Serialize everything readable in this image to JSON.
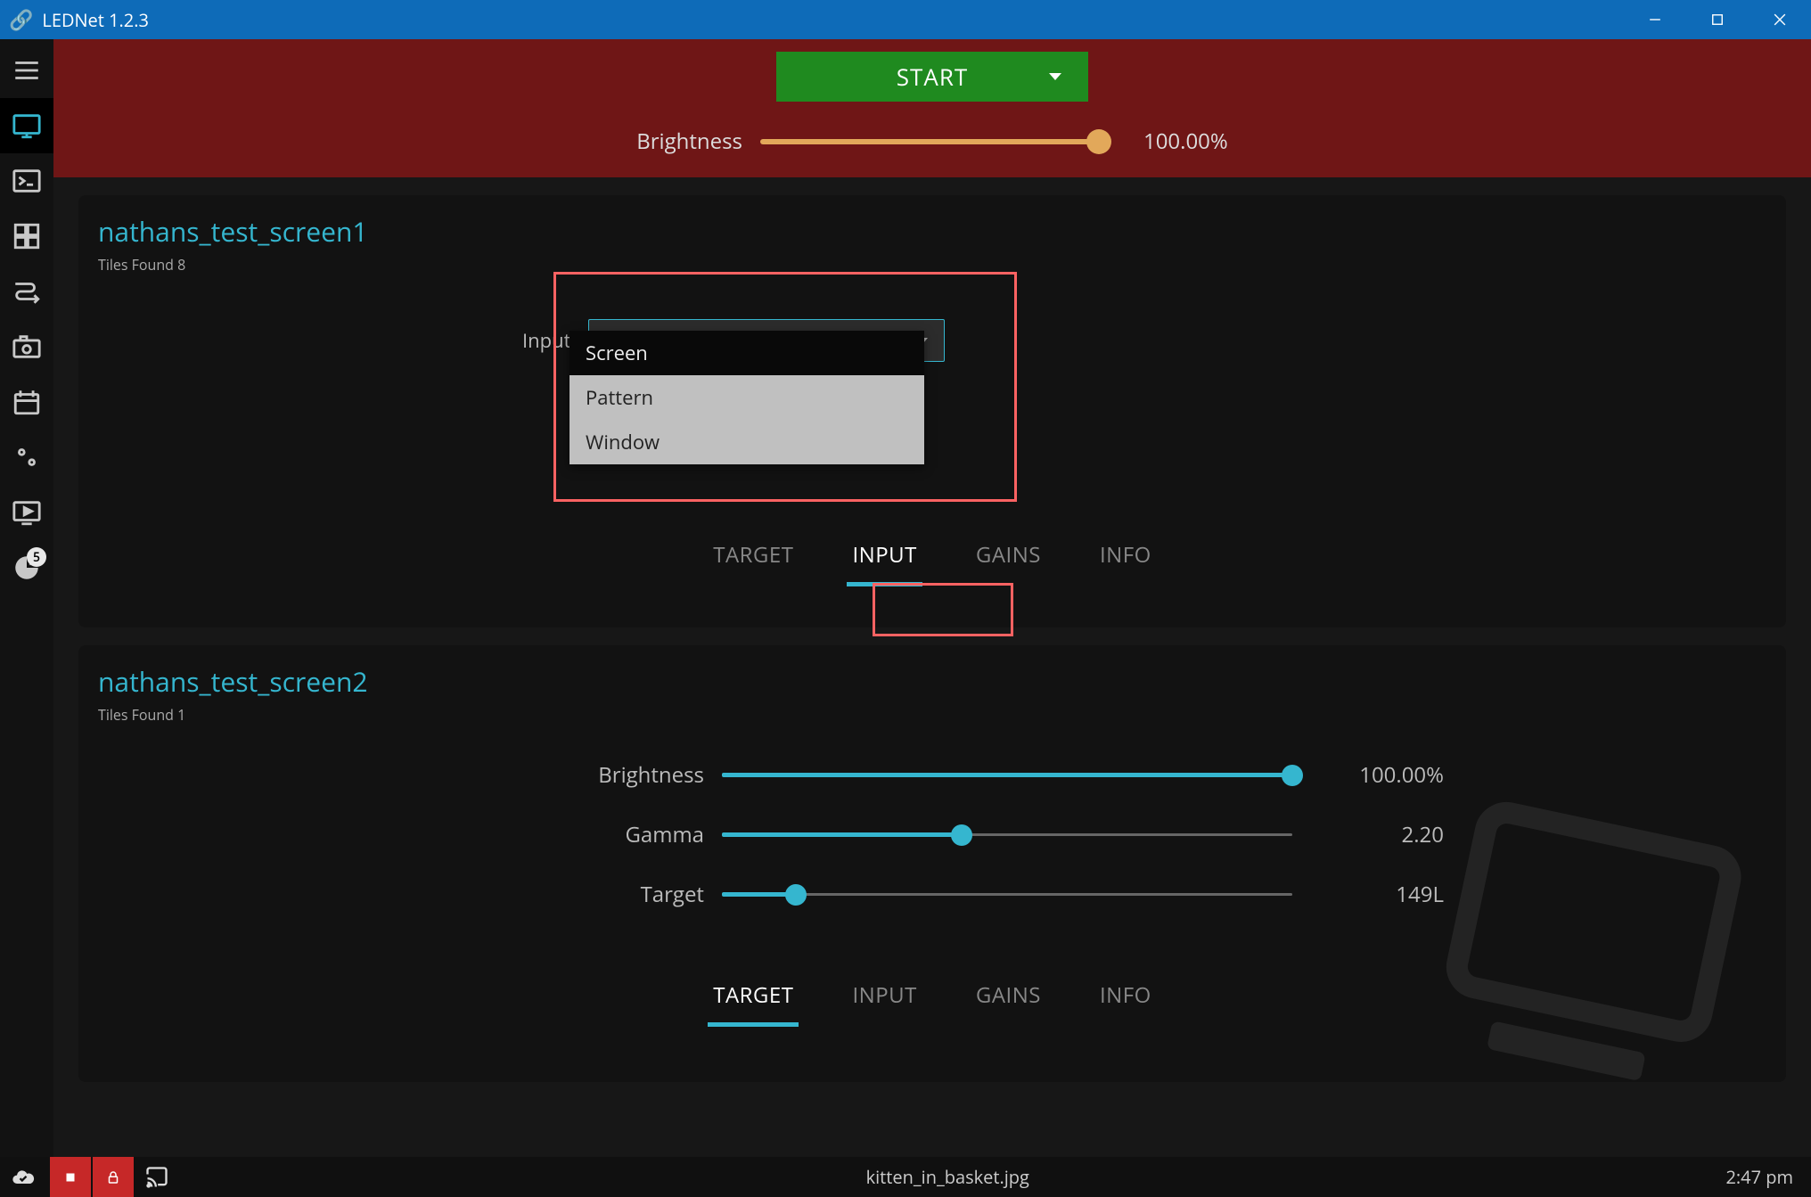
{
  "window": {
    "title": "LEDNet 1.2.3"
  },
  "top": {
    "start_label": "START",
    "brightness_label": "Brightness",
    "brightness_value": "100.00%"
  },
  "sidebar": {
    "badge": "5"
  },
  "screen1": {
    "title": "nathans_test_screen1",
    "subtitle": "Tiles Found 8",
    "input_label": "Input",
    "input_selected": "Window",
    "input_options": [
      "Screen",
      "Pattern",
      "Window"
    ],
    "tabs": {
      "target": "TARGET",
      "input": "INPUT",
      "gains": "GAINS",
      "info": "INFO"
    }
  },
  "screen2": {
    "title": "nathans_test_screen2",
    "subtitle": "Tiles Found 1",
    "brightness_label": "Brightness",
    "brightness_value": "100.00%",
    "gamma_label": "Gamma",
    "gamma_value": "2.20",
    "target_label": "Target",
    "target_value": "149L",
    "tabs": {
      "target": "TARGET",
      "input": "INPUT",
      "gains": "GAINS",
      "info": "INFO"
    }
  },
  "status": {
    "file": "kitten_in_basket.jpg",
    "time": "2:47 pm"
  },
  "colors": {
    "accent": "#35b6cf",
    "titlebar": "#0e6bb8",
    "danger_panel": "#6f1616",
    "start_green": "#1f8a1f",
    "gold": "#e2a85a",
    "highlight": "#fc6262"
  }
}
